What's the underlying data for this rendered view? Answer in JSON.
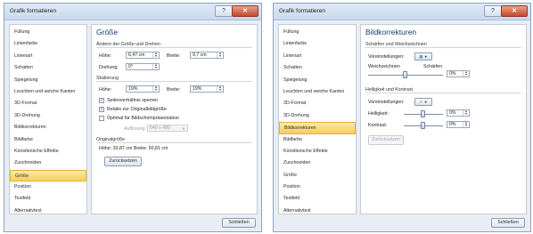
{
  "left_dialog": {
    "title": "Grafik formatieren",
    "nav_items": [
      "Füllung",
      "Linienfarbe",
      "Linienart",
      "Schatten",
      "Spiegelung",
      "Leuchten und weiche Kanten",
      "3D-Format",
      "3D-Drehung",
      "Bildkorrekturen",
      "Bildfarbe",
      "Künstlerische Effekte",
      "Zuschneiden",
      "Größe",
      "Position",
      "Textfeld",
      "Alternativtext"
    ],
    "selected_nav": "Größe",
    "panel_title": "Größe",
    "section_resize": "Ändern der Größe und Drehen",
    "hoehe_label": "Höhe:",
    "hoehe_value": "6,47 cm",
    "breite_label": "Breite:",
    "breite_value": "9,7 cm",
    "drehung_label": "Drehung:",
    "drehung_value": "0°",
    "section_scale": "Skalierung",
    "scale_hoehe_label": "Höhe:",
    "scale_hoehe_value": "19%",
    "scale_breite_label": "Breite:",
    "scale_breite_value": "19%",
    "lock_aspect_label": "Seitenverhältnis sperren",
    "lock_aspect_checked": true,
    "relative_label": "Relativ zur Originalbildgröße",
    "relative_checked": true,
    "optimal_label": "Optimal für Bildschirmpräsentation",
    "optimal_checked": false,
    "aufloesung_label": "Auflösung",
    "aufloesung_value": "640 x 480",
    "section_original": "Originalgröße",
    "orig_text": "Höhe:  33,87 cm  Breite:  50,81 cm",
    "reset_button": "Zurücksetzen",
    "close_button": "Schließen"
  },
  "right_dialog": {
    "title": "Grafik formatieren",
    "nav_items": [
      "Füllung",
      "Linienfarbe",
      "Linienart",
      "Schatten",
      "Spiegelung",
      "Leuchten und weiche Kanten",
      "3D-Format",
      "3D-Drehung",
      "Bildkorrekturen",
      "Bildfarbe",
      "Künstlerische Effekte",
      "Zuschneiden",
      "Größe",
      "Position",
      "Textfeld",
      "Alternativtext"
    ],
    "selected_nav": "Bildkorrekturen",
    "panel_title": "Bildkorrekturen",
    "section_sharpen": "Schärfen und Weichzeichnen",
    "presets_label": "Voreinstellungen:",
    "weich_label": "Weichzeichnen",
    "schaerfen_label": "Schärfen",
    "sharpen_value": "0%",
    "section_brightness": "Helligkeit und Kontrast",
    "presets2_label": "Voreinstellungen:",
    "helligkeit_label": "Helligkeit:",
    "helligkeit_value": "0%",
    "kontrast_label": "Kontrast:",
    "kontrast_value": "0%",
    "reset_button": "Zurücksetzen",
    "close_button": "Schließen"
  },
  "colors": {
    "selection": "#f7cf58",
    "panel_title": "#15396b",
    "close_red": "#c8462c"
  }
}
